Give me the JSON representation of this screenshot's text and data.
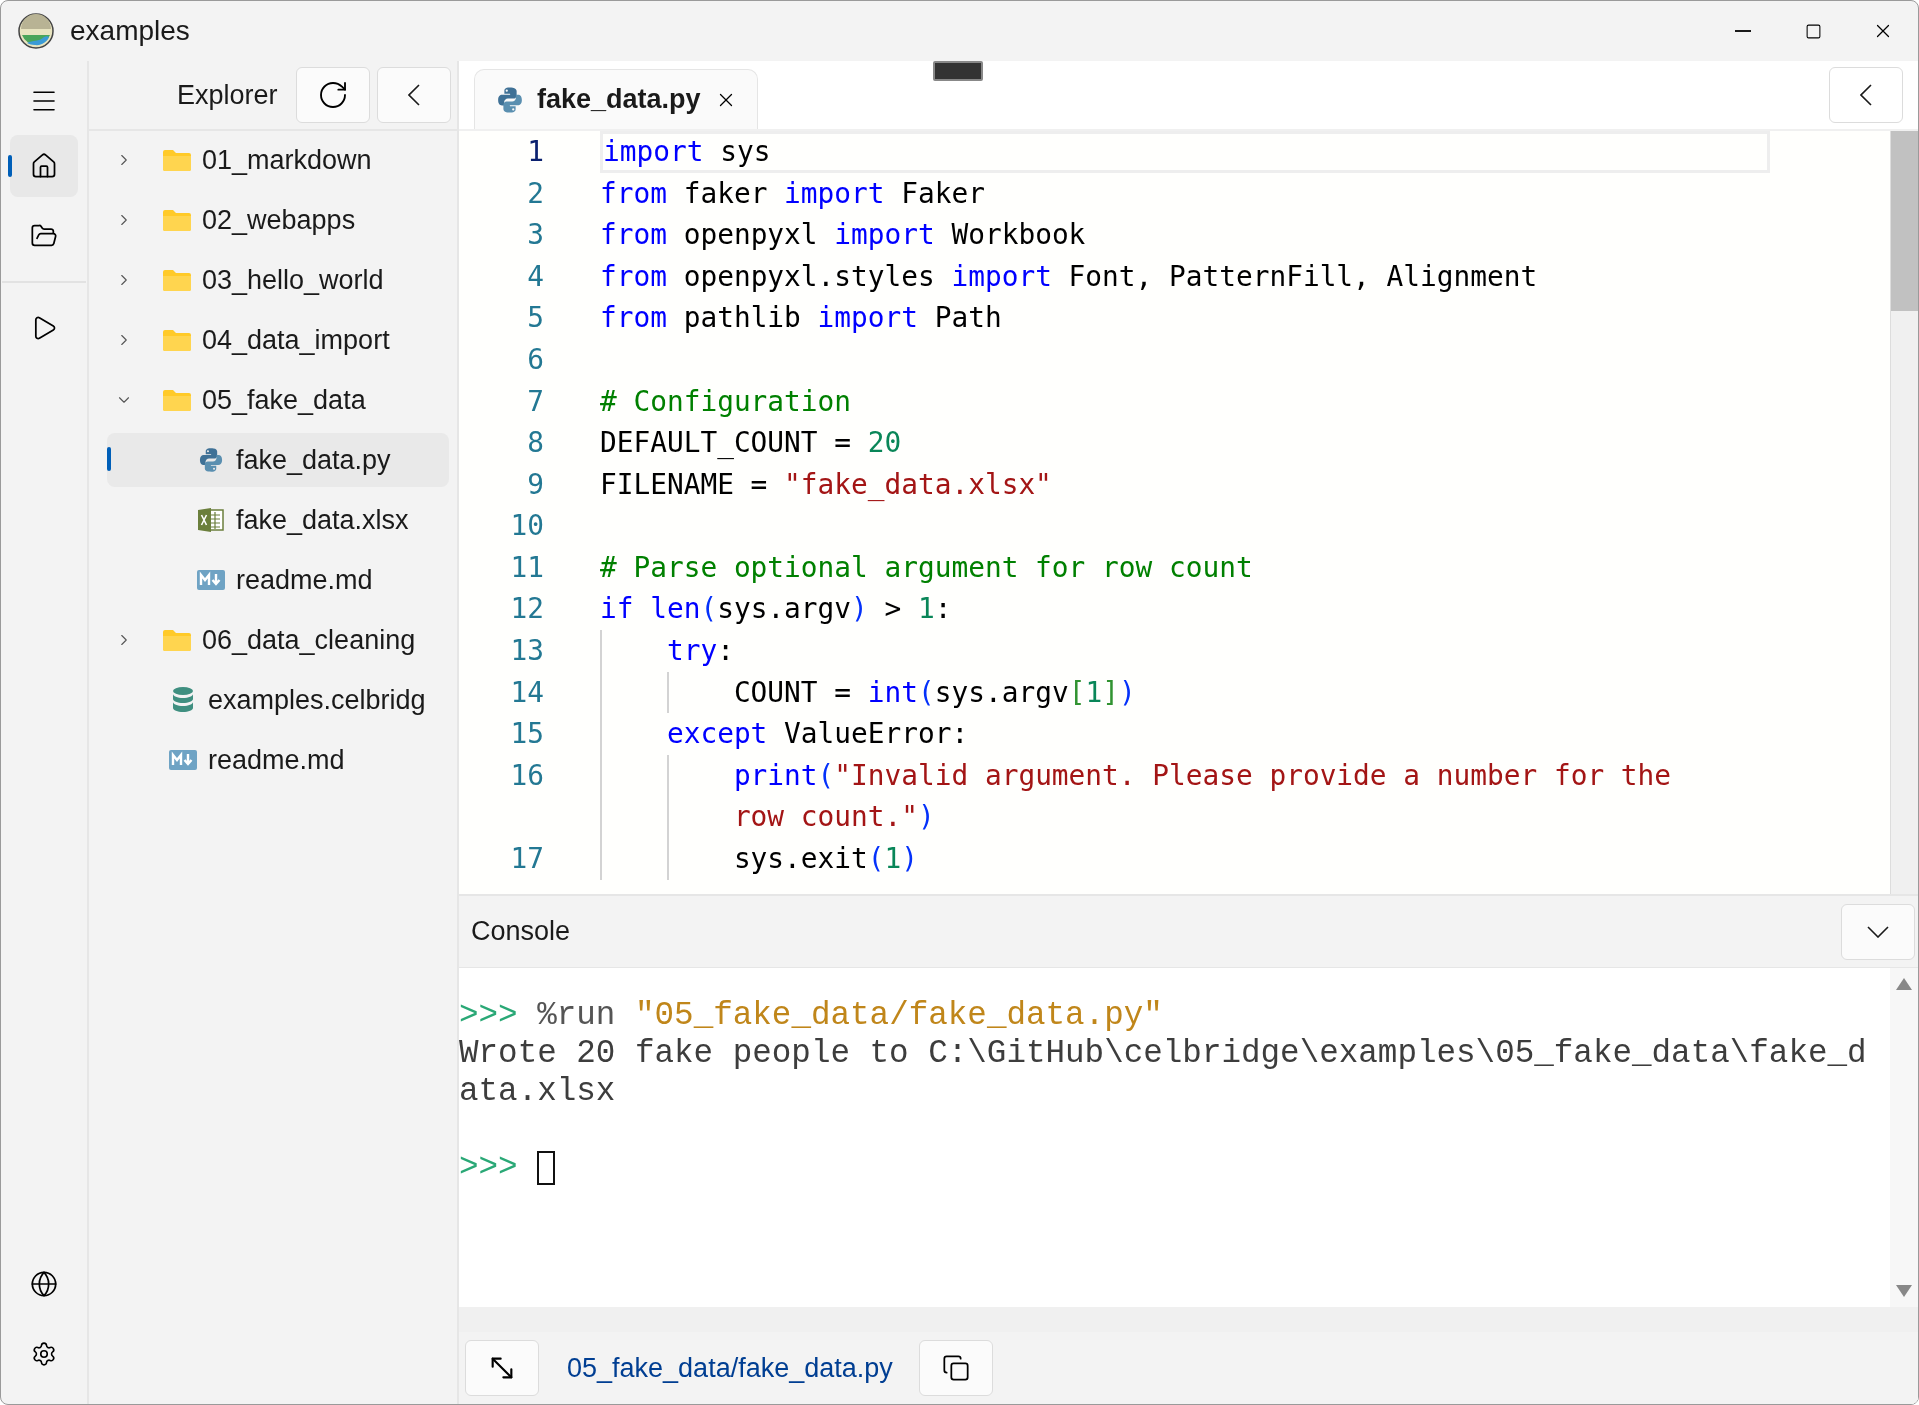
{
  "window": {
    "title": "examples"
  },
  "nav_items": [
    {
      "kind": "home",
      "selected": true
    },
    {
      "kind": "files",
      "selected": false
    },
    {
      "kind": "run",
      "selected": false
    }
  ],
  "explorer": {
    "title": "Explorer",
    "tree": [
      {
        "name": "01_markdown",
        "kind": "folder",
        "expanded": false,
        "selected": false
      },
      {
        "name": "02_webapps",
        "kind": "folder",
        "expanded": false,
        "selected": false
      },
      {
        "name": "03_hello_world",
        "kind": "folder",
        "expanded": false,
        "selected": false
      },
      {
        "name": "04_data_import",
        "kind": "folder",
        "expanded": false,
        "selected": false
      },
      {
        "name": "05_fake_data",
        "kind": "folder",
        "expanded": true,
        "selected": false,
        "children": [
          {
            "name": "fake_data.py",
            "kind": "python",
            "selected": true
          },
          {
            "name": "fake_data.xlsx",
            "kind": "excel",
            "selected": false
          },
          {
            "name": "readme.md",
            "kind": "markdown",
            "selected": false
          }
        ]
      },
      {
        "name": "06_data_cleaning",
        "kind": "folder",
        "expanded": false,
        "selected": false
      },
      {
        "name": "examples.celbridg",
        "kind": "database",
        "selected": false
      },
      {
        "name": "readme.md",
        "kind": "markdown",
        "selected": false
      }
    ]
  },
  "editor": {
    "tabs": [
      {
        "label": "fake_data.py",
        "kind": "python",
        "selected": true
      }
    ],
    "lines": [
      {
        "number": "1",
        "current": true,
        "tokens": [
          {
            "kind": "keyword",
            "text": "import"
          },
          {
            "kind": "text",
            "text": " sys"
          }
        ]
      },
      {
        "number": "2",
        "current": false,
        "tokens": [
          {
            "kind": "keyword",
            "text": "from"
          },
          {
            "kind": "text",
            "text": " faker "
          },
          {
            "kind": "keyword",
            "text": "import"
          },
          {
            "kind": "text",
            "text": " Faker"
          }
        ]
      },
      {
        "number": "3",
        "current": false,
        "tokens": [
          {
            "kind": "keyword",
            "text": "from"
          },
          {
            "kind": "text",
            "text": " openpyxl "
          },
          {
            "kind": "keyword",
            "text": "import"
          },
          {
            "kind": "text",
            "text": " Workbook"
          }
        ]
      },
      {
        "number": "4",
        "current": false,
        "tokens": [
          {
            "kind": "keyword",
            "text": "from"
          },
          {
            "kind": "text",
            "text": " openpyxl.styles "
          },
          {
            "kind": "keyword",
            "text": "import"
          },
          {
            "kind": "text",
            "text": " Font, PatternFill, Alignment"
          }
        ]
      },
      {
        "number": "5",
        "current": false,
        "tokens": [
          {
            "kind": "keyword",
            "text": "from"
          },
          {
            "kind": "text",
            "text": " pathlib "
          },
          {
            "kind": "keyword",
            "text": "import"
          },
          {
            "kind": "text",
            "text": " Path"
          }
        ]
      },
      {
        "number": "6",
        "current": false
      },
      {
        "number": "7",
        "current": false,
        "tokens": [
          {
            "kind": "comment",
            "text": "# Configuration"
          }
        ]
      },
      {
        "number": "8",
        "current": false,
        "tokens": [
          {
            "kind": "text",
            "text": "DEFAULT_COUNT = "
          },
          {
            "kind": "number",
            "text": "20"
          }
        ]
      },
      {
        "number": "9",
        "current": false,
        "tokens": [
          {
            "kind": "text",
            "text": "FILENAME = "
          },
          {
            "kind": "string",
            "text": "\"fake_data.xlsx\""
          }
        ]
      },
      {
        "number": "10",
        "current": false
      },
      {
        "number": "11",
        "current": false,
        "tokens": [
          {
            "kind": "comment",
            "text": "# Parse optional argument for row count"
          }
        ]
      },
      {
        "number": "12",
        "current": false,
        "tokens": [
          {
            "kind": "keyword",
            "text": "if len"
          },
          {
            "kind": "paren",
            "text": "("
          },
          {
            "kind": "text",
            "text": "sys.argv"
          },
          {
            "kind": "paren",
            "text": ")"
          },
          {
            "kind": "text",
            "text": " > "
          },
          {
            "kind": "number",
            "text": "1"
          },
          {
            "kind": "text",
            "text": ":"
          }
        ]
      },
      {
        "number": "13",
        "current": false,
        "tokens": [
          {
            "kind": "keyword",
            "text": "    try"
          },
          {
            "kind": "text",
            "text": ":"
          }
        ]
      },
      {
        "number": "14",
        "current": false,
        "tokens": [
          {
            "kind": "text",
            "text": "        COUNT = "
          },
          {
            "kind": "keyword",
            "text": "int"
          },
          {
            "kind": "paren",
            "text": "("
          },
          {
            "kind": "text",
            "text": "sys.argv"
          },
          {
            "kind": "bracket",
            "text": "["
          },
          {
            "kind": "number",
            "text": "1"
          },
          {
            "kind": "bracket",
            "text": "]"
          },
          {
            "kind": "paren",
            "text": ")"
          }
        ]
      },
      {
        "number": "15",
        "current": false,
        "tokens": [
          {
            "kind": "keyword",
            "text": "    except"
          },
          {
            "kind": "text",
            "text": " ValueError:"
          }
        ]
      },
      {
        "number": "16",
        "current": false,
        "tokens": [
          {
            "kind": "keyword",
            "text": "        print"
          },
          {
            "kind": "paren",
            "text": "("
          },
          {
            "kind": "string",
            "text": "\"Invalid argument. Please provide a number for the"
          }
        ]
      },
      {
        "current": false,
        "tokens": [
          {
            "kind": "string",
            "text": "        row count.\""
          },
          {
            "kind": "paren",
            "text": ")"
          }
        ]
      },
      {
        "number": "17",
        "current": false,
        "tokens": [
          {
            "kind": "text",
            "text": "        sys.exit"
          },
          {
            "kind": "paren",
            "text": "("
          },
          {
            "kind": "number",
            "text": "1"
          },
          {
            "kind": "paren",
            "text": ")"
          }
        ]
      }
    ]
  },
  "console": {
    "title": "Console",
    "entries": [
      {
        "kind": "command",
        "prompt": ">>>",
        "command": "%run",
        "argument": "\"05_fake_data/fake_data.py\""
      },
      {
        "kind": "output",
        "text": "Wrote 20 fake people to C:\\GitHub\\celbridge\\examples\\05_fake_data\\fake_data.xlsx"
      },
      {
        "kind": "input",
        "prompt": ">>>"
      }
    ]
  },
  "footer": {
    "path": "05_fake_data/fake_data.py"
  }
}
